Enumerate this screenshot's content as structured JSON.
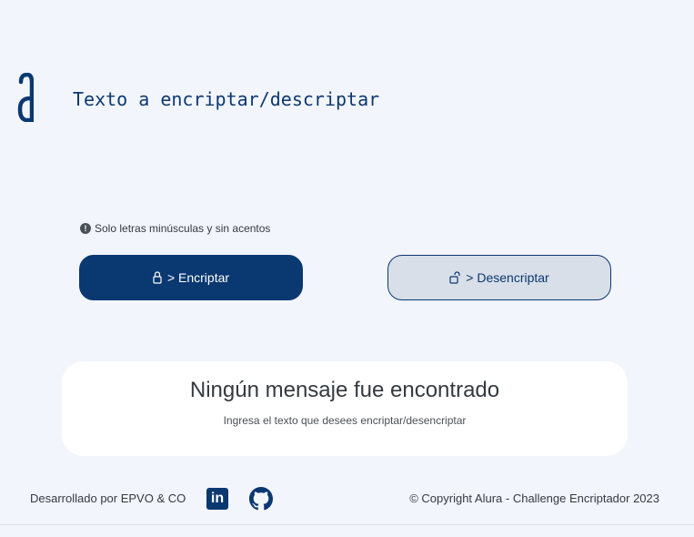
{
  "input": {
    "placeholder": "Texto a encriptar/descriptar"
  },
  "hint": {
    "icon": "exclamation-circle-icon",
    "text": "Solo letras minúsculas y sin acentos"
  },
  "buttons": {
    "encrypt_label": "> Encriptar",
    "encrypt_icon": "lock-icon",
    "decrypt_label": "> Desencriptar",
    "decrypt_icon": "unlock-icon"
  },
  "result": {
    "title": "Ningún mensaje fue encontrado",
    "subtitle": "Ingresa el texto que desees encriptar/desencriptar"
  },
  "footer": {
    "developed_by": "Desarrollado por EPVO & CO",
    "linkedin_icon": "linkedin-icon",
    "github_icon": "github-icon",
    "copyright": "© Copyright Alura - Challenge Encriptador 2023"
  },
  "colors": {
    "background": "#f3f5fc",
    "primary": "#0a3871",
    "secondary_button": "#d8dfe8",
    "card": "#ffffff",
    "text": "#343a40"
  }
}
